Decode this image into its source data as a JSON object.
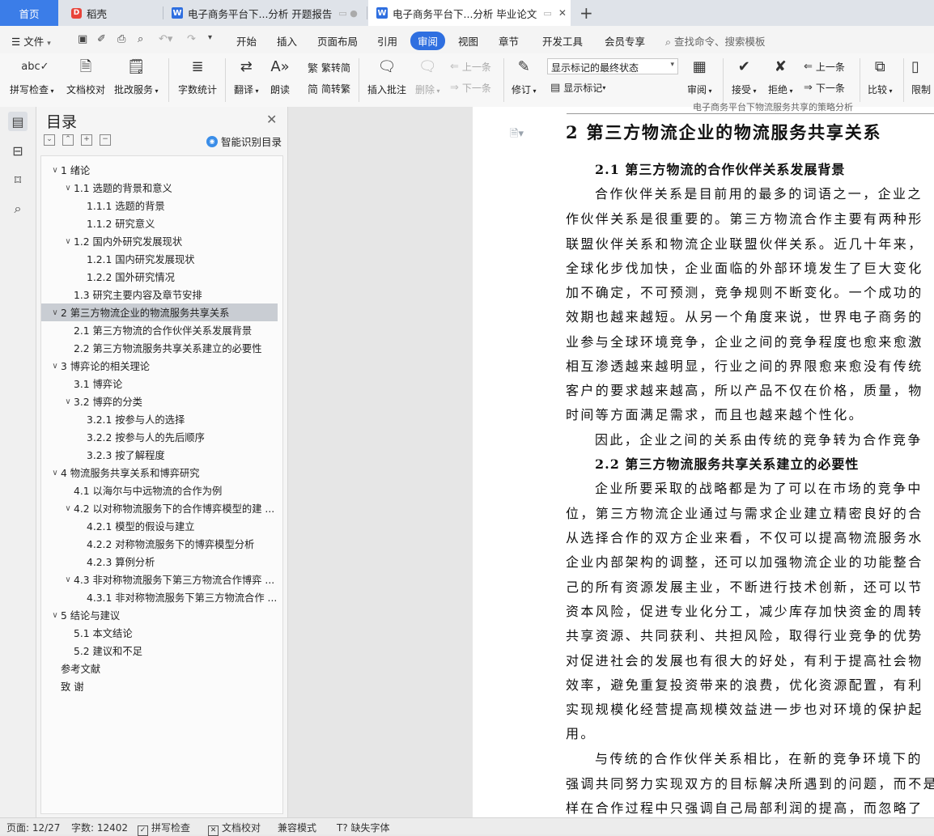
{
  "tabs": {
    "home": "首页",
    "wps": "稻壳",
    "doc1": "电子商务平台下...分析 开题报告",
    "doc2": "电子商务平台下...分析 毕业论文",
    "close": "✕",
    "add": "+"
  },
  "menu": {
    "file": "文件",
    "items": [
      "开始",
      "插入",
      "页面布局",
      "引用",
      "审阅",
      "视图",
      "章节",
      "开发工具",
      "会员专享"
    ],
    "active": "审阅",
    "search": "查找命令、搜索模板"
  },
  "ribbon": {
    "spell": "拼写检查",
    "doc_check": "文档校对",
    "correction": "批改服务",
    "word_count": "字数统计",
    "translate": "翻译",
    "read_aloud": "朗读",
    "trad_simp": "繁转简",
    "simp_trad": "简转繁",
    "insert_comment": "插入批注",
    "delete": "删除",
    "prev_comment": "上一条",
    "next_comment": "下一条",
    "revise": "修订",
    "markup_state": "显示标记的最终状态",
    "show_markup": "显示标记",
    "review": "审阅",
    "accept": "接受",
    "reject": "拒绝",
    "prev_change": "上一条",
    "next_change": "下一条",
    "compare": "比较",
    "restrict": "限制"
  },
  "toc": {
    "title": "目录",
    "smart": "智能识别目录",
    "items": [
      {
        "level": 1,
        "text": "1 绪论",
        "chev": true
      },
      {
        "level": 2,
        "text": "1.1 选题的背景和意义",
        "chev": true
      },
      {
        "level": 3,
        "text": "1.1.1 选题的背景",
        "chev": false
      },
      {
        "level": 3,
        "text": "1.1.2 研究意义",
        "chev": false
      },
      {
        "level": 2,
        "text": "1.2 国内外研究发展现状",
        "chev": true
      },
      {
        "level": 3,
        "text": "1.2.1 国内研究发展现状",
        "chev": false
      },
      {
        "level": 3,
        "text": "1.2.2 国外研究情况",
        "chev": false
      },
      {
        "level": 2,
        "text": "1.3 研究主要内容及章节安排",
        "chev": false
      },
      {
        "level": 1,
        "text": "2 第三方物流企业的物流服务共享关系",
        "chev": true,
        "selected": true
      },
      {
        "level": 2,
        "text": "2.1 第三方物流的合作伙伴关系发展背景",
        "chev": false
      },
      {
        "level": 2,
        "text": "2.2 第三方物流服务共享关系建立的必要性",
        "chev": false
      },
      {
        "level": 1,
        "text": "3 博弈论的相关理论",
        "chev": true
      },
      {
        "level": 2,
        "text": "3.1 博弈论",
        "chev": false
      },
      {
        "level": 2,
        "text": "3.2 博弈的分类",
        "chev": true
      },
      {
        "level": 3,
        "text": "3.2.1 按参与人的选择",
        "chev": false
      },
      {
        "level": 3,
        "text": "3.2.2 按参与人的先后顺序",
        "chev": false
      },
      {
        "level": 3,
        "text": "3.2.3 按了解程度",
        "chev": false
      },
      {
        "level": 1,
        "text": "4 物流服务共享关系和博弈研究",
        "chev": true
      },
      {
        "level": 2,
        "text": "4.1 以海尔与中远物流的合作为例",
        "chev": false
      },
      {
        "level": 2,
        "text": "4.2 以对称物流服务下的合作博弈模型的建 ...",
        "chev": true
      },
      {
        "level": 3,
        "text": "4.2.1 模型的假设与建立",
        "chev": false
      },
      {
        "level": 3,
        "text": "4.2.2 对称物流服务下的博弈模型分析",
        "chev": false
      },
      {
        "level": 3,
        "text": "4.2.3 算例分析",
        "chev": false
      },
      {
        "level": 2,
        "text": "4.3 非对称物流服务下第三方物流合作博弈 ...",
        "chev": true
      },
      {
        "level": 3,
        "text": "4.3.1 非对称物流服务下第三方物流合作 ...",
        "chev": false
      },
      {
        "level": 1,
        "text": "5 结论与建议",
        "chev": true
      },
      {
        "level": 2,
        "text": "5.1 本文结论",
        "chev": false
      },
      {
        "level": 2,
        "text": "5.2 建议和不足",
        "chev": false
      },
      {
        "level": 1,
        "text": "参考文献",
        "chev": false,
        "nochev": true
      },
      {
        "level": 1,
        "text": "致  谢",
        "chev": false,
        "nochev": true
      }
    ]
  },
  "doc": {
    "header": "电子商务平台下物流服务共享的策略分析",
    "lines": [
      {
        "kind": "h1",
        "text": "2 第三方物流企业的物流服务共享关系"
      },
      {
        "kind": "h2",
        "text": "2.1 第三方物流的合作伙伴关系发展背景"
      },
      {
        "kind": "p_indent",
        "text": "合作伙伴关系是目前用的最多的词语之一，企业之"
      },
      {
        "kind": "p",
        "text": "作伙伴关系是很重要的。第三方物流合作主要有两种形"
      },
      {
        "kind": "p",
        "text": "联盟伙伴关系和物流企业联盟伙伴关系。近几十年来，"
      },
      {
        "kind": "p",
        "text": "全球化步伐加快，企业面临的外部环境发生了巨大变化"
      },
      {
        "kind": "p",
        "text": "加不确定，不可预测，竞争规则不断变化。一个成功的"
      },
      {
        "kind": "p",
        "text": "效期也越来越短。从另一个角度来说，世界电子商务的"
      },
      {
        "kind": "p",
        "text": "业参与全球环境竞争，企业之间的竞争程度也愈来愈激"
      },
      {
        "kind": "p",
        "text": "相互渗透越来越明显，行业之间的界限愈来愈没有传统"
      },
      {
        "kind": "p",
        "text": "客户的要求越来越高，所以产品不仅在价格，质量，物"
      },
      {
        "kind": "p",
        "text": "时间等方面满足需求，而且也越来越个性化。"
      },
      {
        "kind": "p_indent",
        "text": "因此，企业之间的关系由传统的竞争转为合作竞争"
      },
      {
        "kind": "h2",
        "text": "2.2 第三方物流服务共享关系建立的必要性"
      },
      {
        "kind": "p_indent",
        "text": "企业所要采取的战略都是为了可以在市场的竞争中"
      },
      {
        "kind": "p",
        "text": "位，第三方物流企业通过与需求企业建立精密良好的合"
      },
      {
        "kind": "p",
        "text": "从选择合作的双方企业来看，不仅可以提高物流服务水"
      },
      {
        "kind": "p",
        "text": "企业内部架构的调整，还可以加强物流企业的功能整合"
      },
      {
        "kind": "p",
        "text": "己的所有资源发展主业，不断进行技术创新，还可以节"
      },
      {
        "kind": "p",
        "text": "资本风险，促进专业化分工，减少库存加快资金的周转"
      },
      {
        "kind": "p",
        "text": "共享资源、共同获利、共担风险，取得行业竞争的优势"
      },
      {
        "kind": "p",
        "text": "对促进社会的发展也有很大的好处，有利于提高社会物"
      },
      {
        "kind": "p",
        "text": "效率，避免重复投资带来的浪费，优化资源配置，有利"
      },
      {
        "kind": "p",
        "text": "实现规模化经营提高规模效益进一步也对环境的保护起"
      },
      {
        "kind": "p",
        "text": "用。"
      },
      {
        "kind": "p_indent",
        "text": "与传统的合作伙伴关系相比，在新的竞争环境下的"
      },
      {
        "kind": "p",
        "text": "强调共同努力实现双方的目标解决所遇到的问题，而不是"
      },
      {
        "kind": "p",
        "text": "样在合作过程中只强调自己局部利润的提高，而忽略了"
      }
    ]
  },
  "status": {
    "page": "页面: 12/27",
    "words": "字数: 12402",
    "spell": "拼写检查",
    "doc_check": "文档校对",
    "compat": "兼容模式",
    "missing_font": "缺失字体"
  }
}
